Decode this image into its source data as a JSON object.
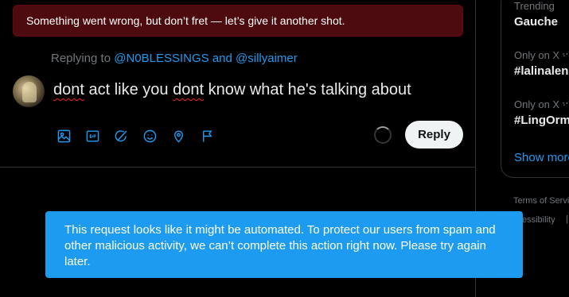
{
  "error_banner": {
    "text": "Something went wrong, but don’t fret — let’s give it another shot."
  },
  "reply": {
    "replying_prefix": "Replying to",
    "handle_1": "@N0BLESSINGS",
    "conjunction": "and",
    "handle_2": "@sillyaimer",
    "text_word_1": "dont",
    "text_middle": " act like you ",
    "text_word_2": "dont",
    "text_end": " know what he's talking about",
    "button_label": "Reply"
  },
  "toolbar": {
    "icons": [
      "image-icon",
      "gif-icon",
      "grok-icon",
      "emoji-icon",
      "location-icon",
      "flag-icon"
    ]
  },
  "sidebar": {
    "trends": [
      {
        "meta": "Trending",
        "name": "Gauche"
      },
      {
        "meta": "Only on X · T",
        "name": "#lalinalen"
      },
      {
        "meta": "Only on X · T",
        "name": "#LingOrm"
      }
    ],
    "show_more": "Show more",
    "footer_1": "Terms of Servic",
    "footer_2": "ccessibility",
    "footer_sep": "|"
  },
  "toast": {
    "text": "This request looks like it might be automated. To protect our users from spam and other malicious activity, we can’t complete this action right now. Please try again later."
  },
  "colors": {
    "accent": "#1d9bf0",
    "error_bg": "#4d0b10",
    "background": "#000000"
  }
}
